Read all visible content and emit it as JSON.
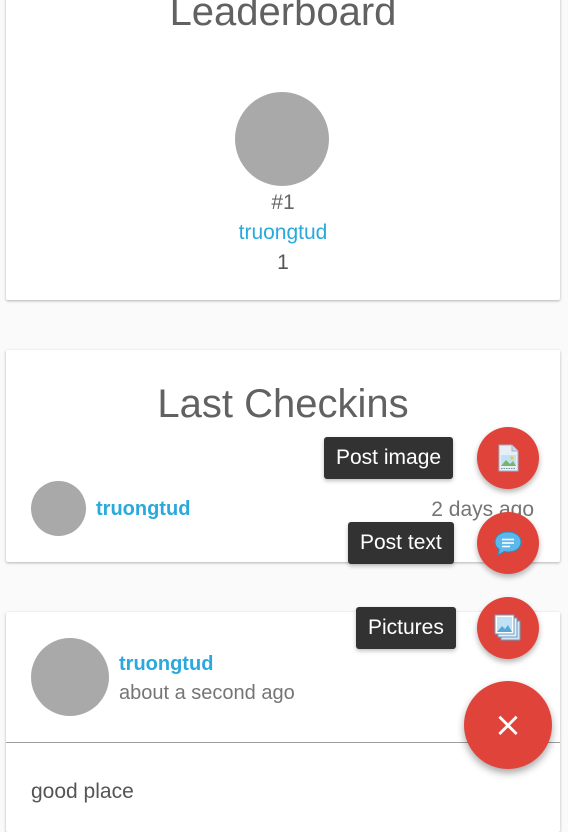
{
  "leaderboard": {
    "title": "Leaderboard",
    "rank": "#1",
    "username": "truongtud",
    "score": "1"
  },
  "last_checkins": {
    "title": "Last Checkins",
    "items": [
      {
        "username": "truongtud",
        "time": "2 days ago"
      }
    ]
  },
  "post": {
    "username": "truongtud",
    "time": "about a second ago",
    "text": "good place"
  },
  "fab_menu": {
    "actions": [
      {
        "label": "Post image",
        "icon": "image-file-icon"
      },
      {
        "label": "Post text",
        "icon": "chat-bubble-icon"
      },
      {
        "label": "Pictures",
        "icon": "pictures-icon"
      }
    ],
    "main_icon": "close-icon",
    "main_glyph": "×",
    "accent_color": "#e0433a"
  },
  "colors": {
    "link": "#2aa9dd",
    "avatar_placeholder": "#a9a9a9"
  }
}
